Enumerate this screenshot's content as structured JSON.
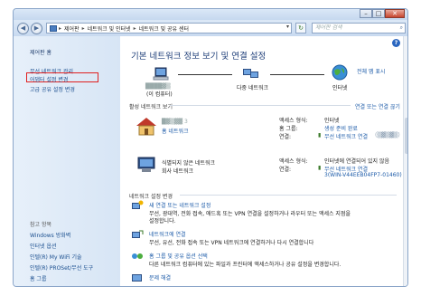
{
  "window": {
    "min": "–",
    "max": "□",
    "close": "✕"
  },
  "nav": {
    "back": "◀",
    "forward": "▶",
    "crumbs": [
      "제어판",
      "네트워크 및 인터넷",
      "네트워크 및 공유 센터"
    ],
    "refresh": "↻",
    "search_placeholder": "제어판 검색"
  },
  "sidebar": {
    "top": [
      "제어판 홈",
      "무선 네트워크 관리",
      "어댑터 설정 변경",
      "고급 공유 설정 변경"
    ],
    "see_also_title": "참고 항목",
    "see_also": [
      "Windows 방화벽",
      "인터넷 옵션",
      "인텔(R) My WiFi 기술",
      "인텔(R) PROSet/무선 도구",
      "홈 그룹"
    ]
  },
  "main": {
    "title": "기본 네트워크 정보 보기 및 연결 설정",
    "full_map": "전체 맵 표시",
    "map": {
      "computer_label": "(이 컴퓨터)",
      "network": "다중 네트워크",
      "internet": "인터넷"
    },
    "active_header": "활성 네트워크 보기",
    "connect_disconnect": "연결 또는 연결 끊기",
    "net1": {
      "type": "홈 네트워크",
      "access_label": "액세스 형식:",
      "access_value": "인터넷",
      "homegroup_label": "홈 그룹:",
      "homegroup_value": "생성 준비 완료",
      "conn_label": "연결:",
      "conn_value": "무선 네트워크 연결"
    },
    "net2": {
      "name": "식별되지 않은 네트워크",
      "type": "회사 네트워크",
      "access_label": "액세스 형식:",
      "access_value": "인터넷에 연결되어 있지 않음",
      "conn_label": "연결:",
      "conn_value": "무선 네트워크 연결",
      "conn_value2": "3(WIN-V44EEB04FP7-01460)"
    },
    "change_header": "네트워크 설정 변경",
    "tasks": [
      {
        "title": "새 연결 또는 네트워크 설정",
        "desc": "무선, 광대역, 전화 접속, 애드혹 또는 VPN 연결을 설정하거나 라우터 또는 액세스 지점을",
        "desc2": "설정합니다."
      },
      {
        "title": "네트워크에 연결",
        "desc": "무선, 유선, 전화 접속 또는 VPN 네트워크에 연결하거나 다시 연결합니다"
      },
      {
        "title": "홈 그룹 및 공유 옵션 선택",
        "desc": "다른 네트워크 컴퓨터에 있는 파일과 프린터에 액세스하거나 공유 설정을 변경합니다."
      },
      {
        "title": "문제 해결"
      }
    ]
  },
  "help": "?"
}
